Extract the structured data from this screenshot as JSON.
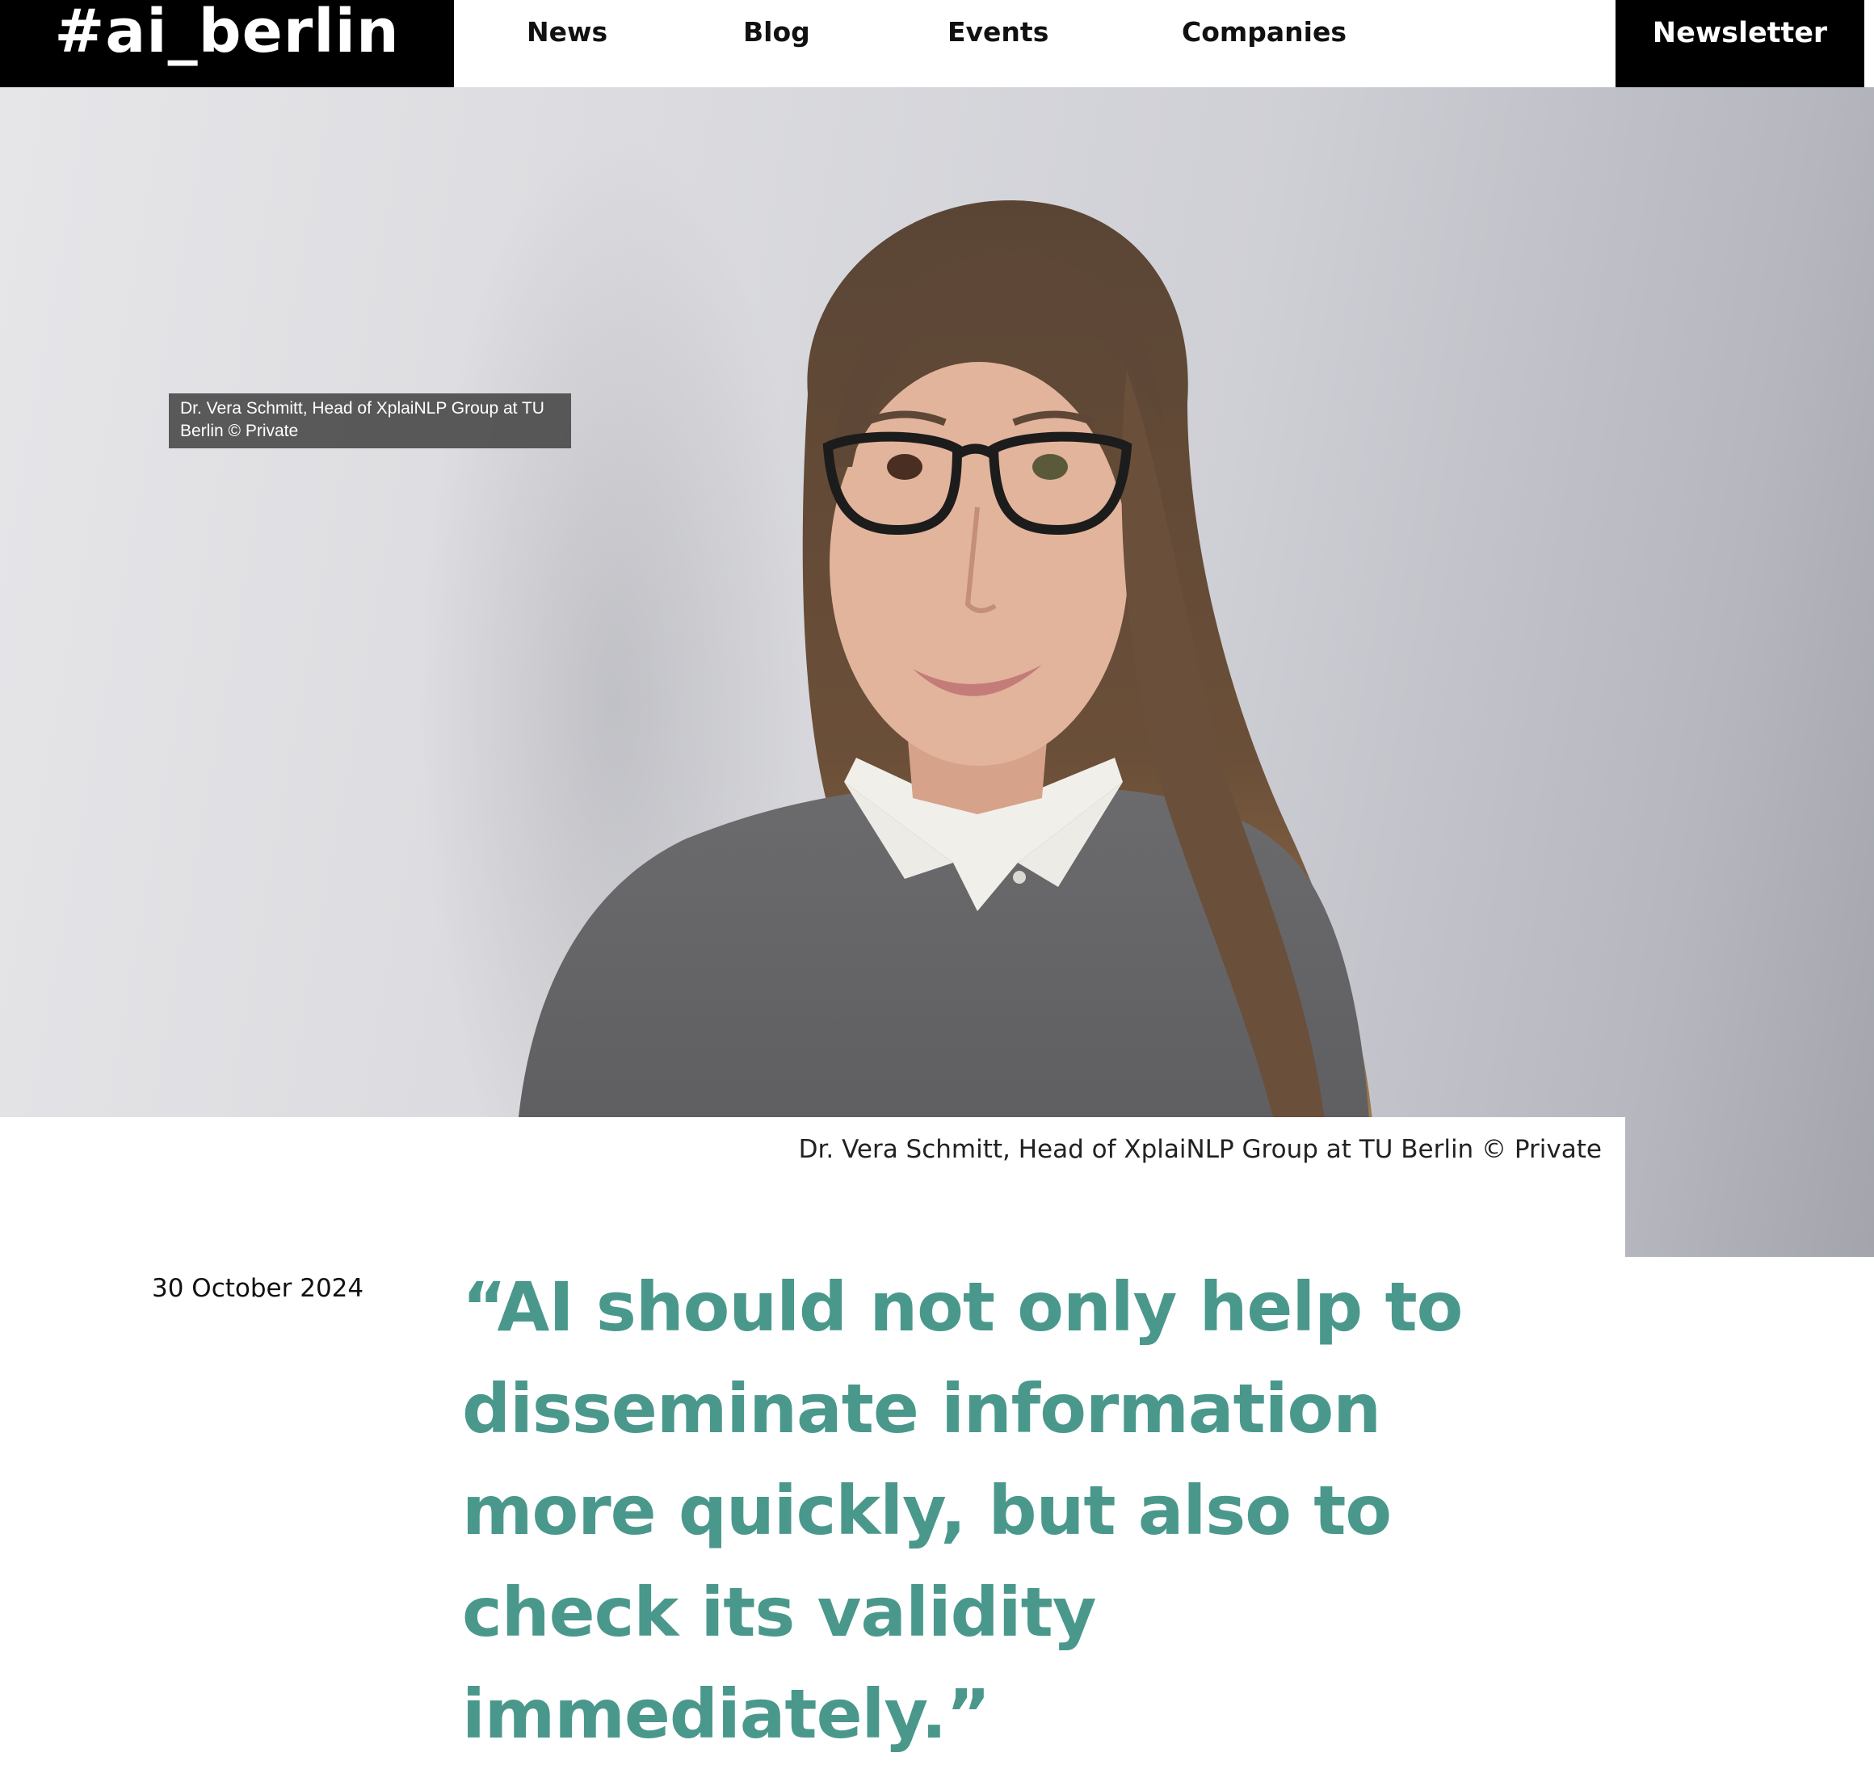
{
  "header": {
    "logo": "#ai_berlin",
    "nav": [
      "News",
      "Blog",
      "Events",
      "Companies"
    ],
    "newsletter": "Newsletter"
  },
  "hero": {
    "tooltip": "Dr. Vera Schmitt, Head of XplaiNLP Group at TU Berlin © Private"
  },
  "article": {
    "caption": "Dr. Vera Schmitt, Head of XplaiNLP Group at TU Berlin © Private",
    "date": "30 October 2024",
    "headline": "“AI should not only help to disseminate information more quickly, but also to check its validity immediately.”"
  },
  "colors": {
    "accent": "#4a988c",
    "header_black": "#000000"
  }
}
